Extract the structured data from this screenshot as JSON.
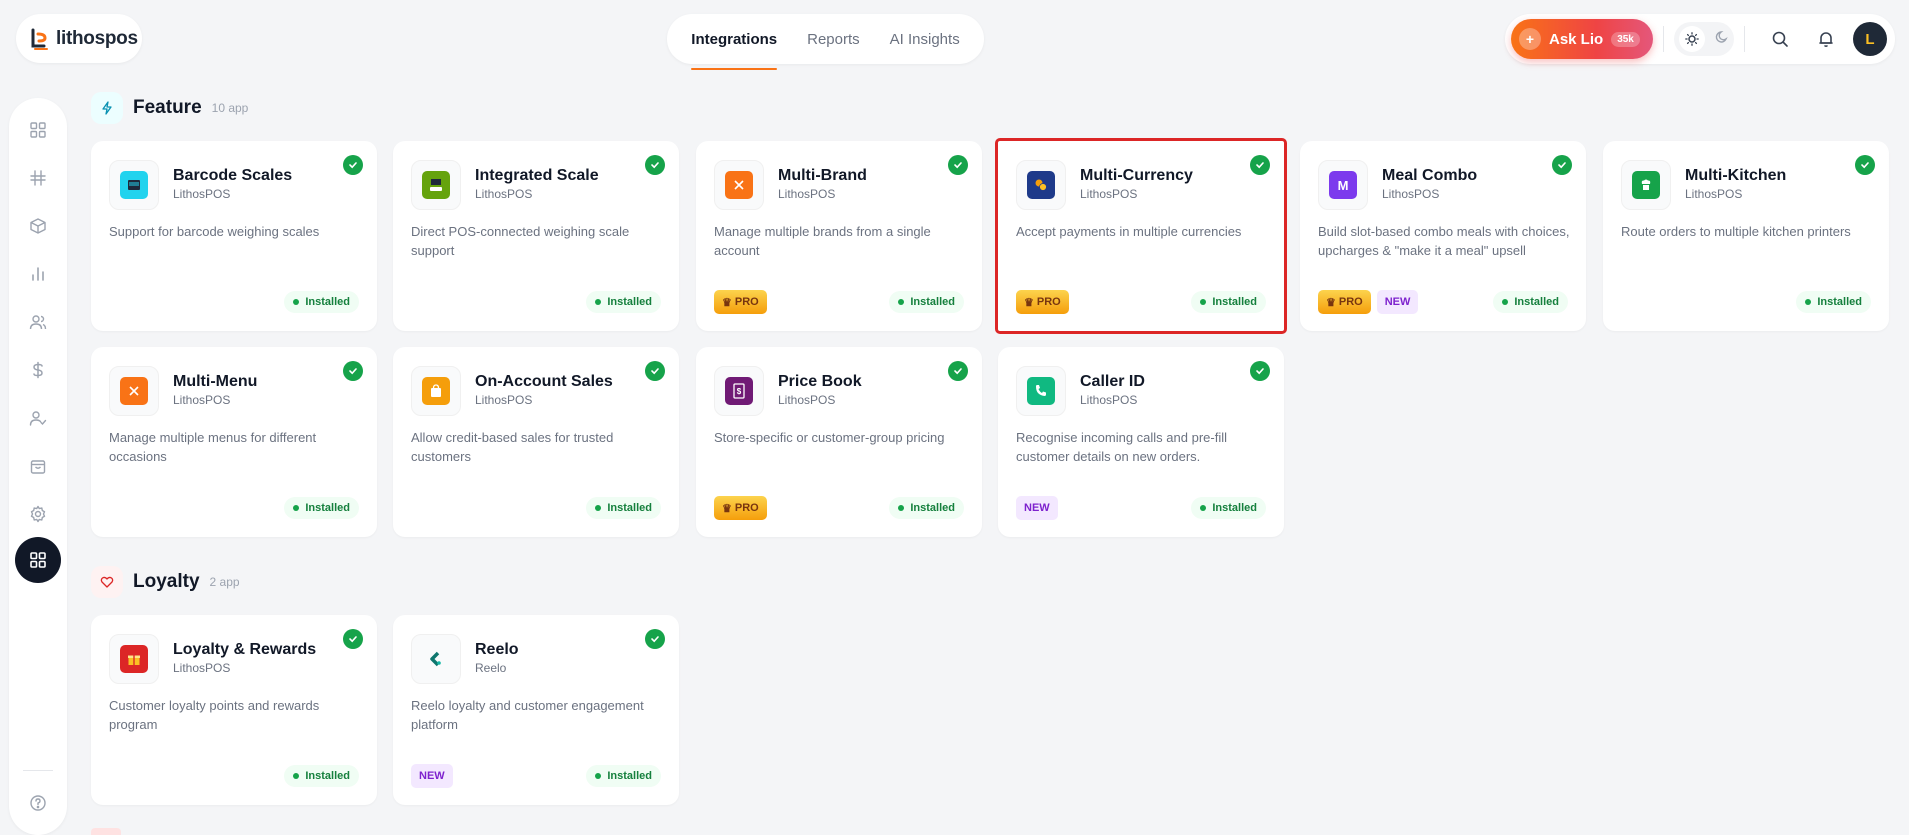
{
  "brand": {
    "name": "lithospos"
  },
  "nav": {
    "tabs": [
      {
        "label": "Integrations"
      },
      {
        "label": "Reports"
      },
      {
        "label": "AI Insights"
      }
    ]
  },
  "header": {
    "ask_label": "Ask Lio",
    "ask_count": "35k",
    "avatar_letter": "L"
  },
  "sidebar": {
    "items": [
      "dashboard-icon",
      "hash-icon",
      "box-icon",
      "chart-icon",
      "users-icon",
      "dollar-icon",
      "user-check-icon",
      "bag-icon",
      "gear-icon",
      "apps-icon",
      "help-icon"
    ]
  },
  "sections": [
    {
      "title": "Feature",
      "count": "10 app",
      "cards": [
        {
          "name": "Barcode Scales",
          "vendor": "LithosPOS",
          "desc": "Support for barcode weighing scales",
          "status": "Installed",
          "icon_color": "#22d3ee"
        },
        {
          "name": "Integrated Scale",
          "vendor": "LithosPOS",
          "desc": "Direct POS-connected weighing scale support",
          "status": "Installed",
          "icon_color": "#65a30d"
        },
        {
          "name": "Multi-Brand",
          "vendor": "LithosPOS",
          "desc": "Manage multiple brands from a single account",
          "status": "Installed",
          "pro": "PRO",
          "icon_color": "#f97316"
        },
        {
          "name": "Multi-Currency",
          "vendor": "LithosPOS",
          "desc": "Accept payments in multiple currencies",
          "status": "Installed",
          "pro": "PRO",
          "icon_color": "#1e3a8a"
        },
        {
          "name": "Meal Combo",
          "vendor": "LithosPOS",
          "desc": "Build slot-based combo meals with choices, upcharges & \"make it a meal\" upsell",
          "status": "Installed",
          "pro": "PRO",
          "new": "NEW",
          "icon_color": "#7c3aed",
          "icon_letter": "M"
        },
        {
          "name": "Multi-Kitchen",
          "vendor": "LithosPOS",
          "desc": "Route orders to multiple kitchen printers",
          "status": "Installed",
          "icon_color": "#16a34a"
        },
        {
          "name": "Multi-Menu",
          "vendor": "LithosPOS",
          "desc": "Manage multiple menus for different occasions",
          "status": "Installed",
          "icon_color": "#f97316"
        },
        {
          "name": "On-Account Sales",
          "vendor": "LithosPOS",
          "desc": "Allow credit-based sales for trusted customers",
          "status": "Installed",
          "icon_color": "#f59e0b"
        },
        {
          "name": "Price Book",
          "vendor": "LithosPOS",
          "desc": "Store-specific or customer-group pricing",
          "status": "Installed",
          "pro": "PRO",
          "icon_color": "#701a75"
        },
        {
          "name": "Caller ID",
          "vendor": "LithosPOS",
          "desc": "Recognise incoming calls and pre-fill customer details on new orders.",
          "status": "Installed",
          "new": "NEW",
          "icon_color": "#10b981"
        }
      ]
    },
    {
      "title": "Loyalty",
      "count": "2 app",
      "cards": [
        {
          "name": "Loyalty & Rewards",
          "vendor": "LithosPOS",
          "desc": "Customer loyalty points and rewards program",
          "status": "Installed",
          "icon_color": "#dc2626"
        },
        {
          "name": "Reelo",
          "vendor": "Reelo",
          "desc": "Reelo loyalty and customer engagement platform",
          "status": "Installed",
          "new": "NEW",
          "icon_color": "#0f766e"
        }
      ]
    }
  ]
}
